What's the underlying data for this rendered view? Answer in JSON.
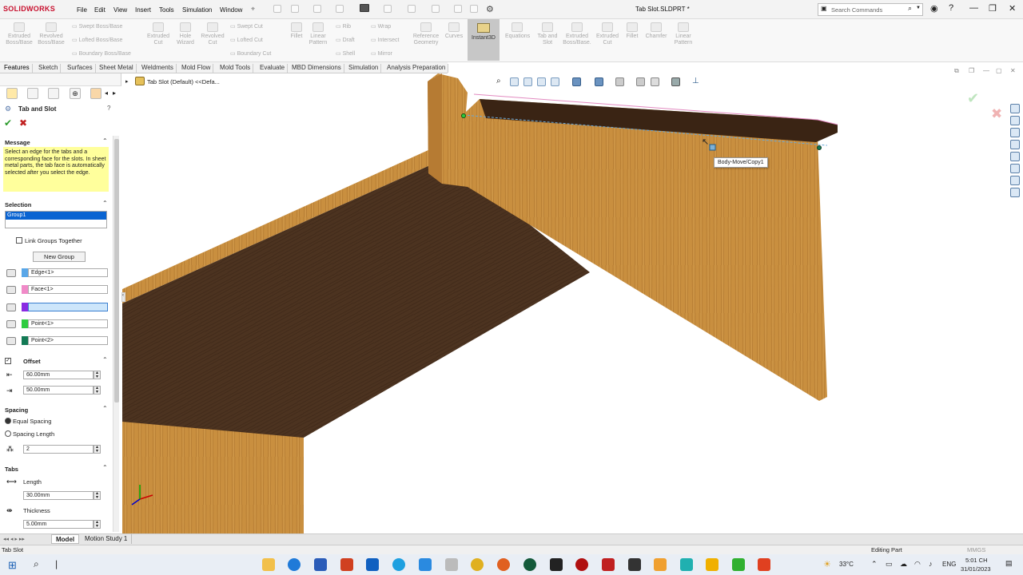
{
  "app": {
    "logo": "SOLIDWORKS",
    "window_title": "Tab Slot.SLDPRT *"
  },
  "menu": [
    "File",
    "Edit",
    "View",
    "Insert",
    "Tools",
    "Simulation",
    "Window"
  ],
  "search": {
    "placeholder": "Search Commands"
  },
  "ribbon": {
    "big": [
      {
        "label": "Extruded Boss/Base"
      },
      {
        "label": "Revolved Boss/Base"
      },
      {
        "label": "Extruded Cut"
      },
      {
        "label": "Hole Wizard"
      },
      {
        "label": "Revolved Cut"
      },
      {
        "label": "Fillet"
      },
      {
        "label": "Linear Pattern"
      },
      {
        "label": "Reference Geometry"
      },
      {
        "label": "Curves"
      },
      {
        "label": "Instant3D"
      },
      {
        "label": "Equations"
      },
      {
        "label": "Tab and Slot"
      },
      {
        "label": "Extruded Boss/Base."
      },
      {
        "label": "Extruded Cut"
      },
      {
        "label": "Fillet"
      },
      {
        "label": "Chamfer"
      },
      {
        "label": "Linear Pattern"
      }
    ],
    "small": [
      "Swept Boss/Base",
      "Lofted Boss/Base",
      "Boundary Boss/Base",
      "Swept Cut",
      "Lofted Cut",
      "Boundary Cut",
      "Rib",
      "Draft",
      "Shell",
      "Wrap",
      "Intersect",
      "Mirror"
    ]
  },
  "tabs": [
    "Features",
    "Sketch",
    "Surfaces",
    "Sheet Metal",
    "Weldments",
    "Mold Flow",
    "Mold Tools",
    "Evaluate",
    "MBD Dimensions",
    "Simulation",
    "Analysis Preparation"
  ],
  "tree": {
    "node": "Tab Slot (Default) <<Defa..."
  },
  "panel": {
    "title": "Tab and Slot",
    "message_header": "Message",
    "message": "Select an edge for the tabs and a corresponding face for the slots. In sheet metal parts, the tab face is automatically selected after you select the edge.",
    "selection_header": "Selection",
    "group": "Group1",
    "link_groups": "Link Groups Together",
    "new_group": "New Group",
    "selections": [
      {
        "value": "Edge<1>",
        "color": "#5aa7e8"
      },
      {
        "value": "Face<1>",
        "color": "#f08ac8"
      },
      {
        "value": "",
        "color": "#8a2be2"
      },
      {
        "value": "Point<1>",
        "color": "#2ecc40"
      },
      {
        "value": "Point<2>",
        "color": "#137a55"
      }
    ],
    "offset_header": "Offset",
    "offset1": "60.00mm",
    "offset2": "50.00mm",
    "spacing_header": "Spacing",
    "equal_spacing": "Equal Spacing",
    "spacing_length": "Spacing Length",
    "spacing_count": "2",
    "tabs_header": "Tabs",
    "length_label": "Length",
    "length": "30.00mm",
    "thickness_label": "Thickness",
    "thickness": "5.00mm"
  },
  "viewport": {
    "tooltip": "Body-Move/Copy1"
  },
  "bottom_tabs": [
    "Model",
    "Motion Study 1"
  ],
  "status": {
    "left": "Tab Slot",
    "mode": "Editing Part",
    "units": "MMGS"
  },
  "taskbar": {
    "temp": "33°C",
    "lang": "ENG",
    "time": "5:01 CH",
    "date": "31/01/2023"
  }
}
